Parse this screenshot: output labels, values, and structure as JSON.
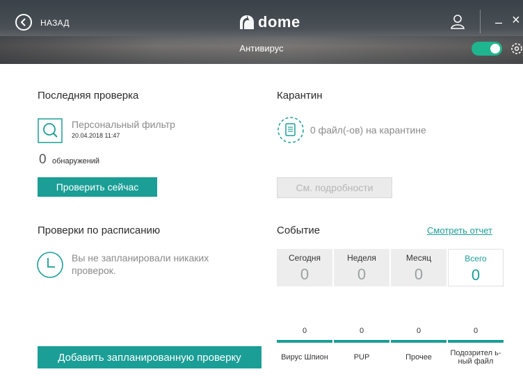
{
  "header": {
    "back_label": "НАЗАД",
    "logo_text": "dome",
    "page_title": "Антивирус",
    "accent": "#1fb58f"
  },
  "last_scan": {
    "heading": "Последняя проверка",
    "filter_name": "Персональный фильтр",
    "date": "20.04.2018 11:47",
    "detections_count": "0",
    "detections_label": "обнаружений",
    "scan_button": "Проверить сейчас"
  },
  "quarantine": {
    "heading": "Карантин",
    "status": "0 файл(-ов) на карантине",
    "details_button": "См. подробности"
  },
  "schedule": {
    "heading": "Проверки по расписанию",
    "message": "Вы не запланировали никаких проверок.",
    "add_button": "Добавить запланированную проверку"
  },
  "events": {
    "heading": "Событие",
    "report_link": "Смотреть отчет",
    "tabs": [
      {
        "label": "Сегодня",
        "value": "0"
      },
      {
        "label": "Неделя",
        "value": "0"
      },
      {
        "label": "Месяц",
        "value": "0"
      },
      {
        "label": "Всего",
        "value": "0"
      }
    ],
    "categories": [
      {
        "count": "0",
        "label": "Вирус Шпион"
      },
      {
        "count": "0",
        "label": "PUP"
      },
      {
        "count": "0",
        "label": "Прочее"
      },
      {
        "count": "0",
        "label": "Подозрител ь- ный файл"
      }
    ]
  },
  "colors": {
    "teal": "#1a9e96",
    "toggle_on": "#1fb58f"
  }
}
